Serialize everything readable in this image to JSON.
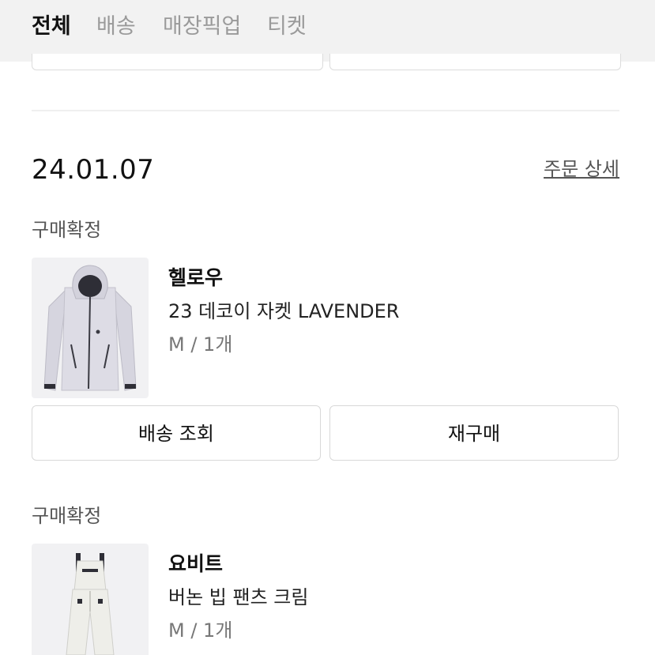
{
  "tabs": [
    {
      "label": "전체",
      "active": true
    },
    {
      "label": "배송",
      "active": false
    },
    {
      "label": "매장픽업",
      "active": false
    },
    {
      "label": "티켓",
      "active": false
    }
  ],
  "order": {
    "date": "24.01.07",
    "detail_link": "주문 상세",
    "items": [
      {
        "status": "구매확정",
        "brand": "헬로우",
        "name": "23 데코이 자켓 LAVENDER",
        "option": "M / 1개",
        "actions": [
          "배송 조회",
          "재구매"
        ]
      },
      {
        "status": "구매확정",
        "brand": "요비트",
        "name": "버논 빕 팬츠 크림",
        "option": "M / 1개"
      }
    ]
  },
  "colors": {
    "tab_bar_bg": "#f2f2f2",
    "active_tab": "#111111",
    "inactive_tab": "#9a9a9a",
    "jacket": "#d9d8e2",
    "pants": "#ecece7"
  }
}
